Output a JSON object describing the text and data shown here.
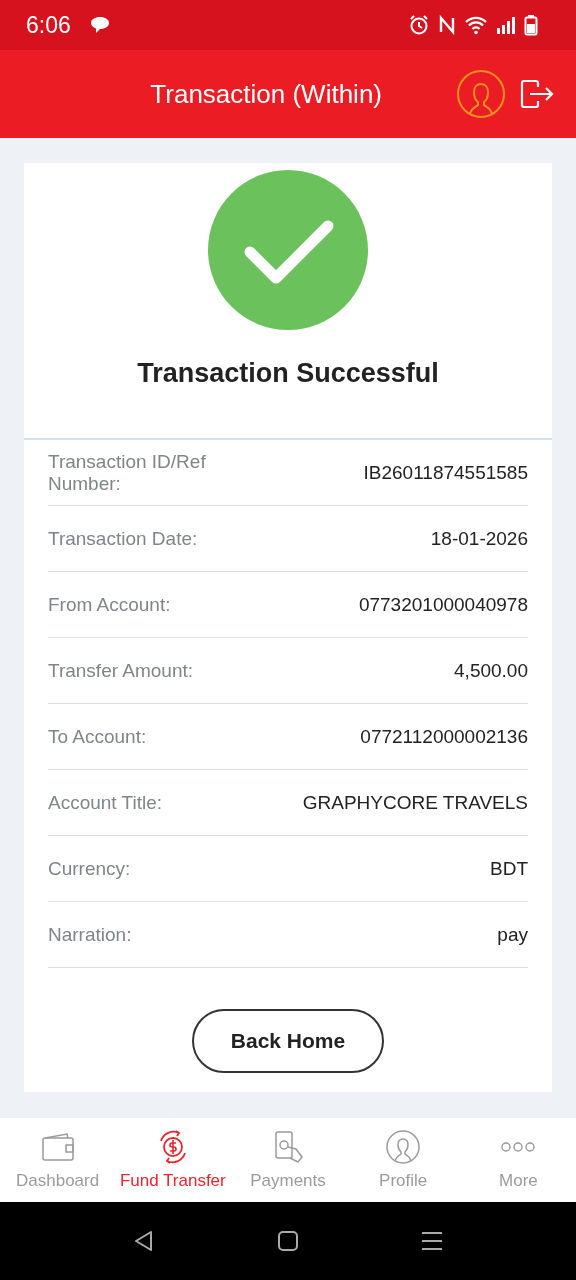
{
  "status_bar": {
    "time": "6:06"
  },
  "header": {
    "title": "Transaction (Within)"
  },
  "result": {
    "title": "Transaction Successful"
  },
  "details": [
    {
      "label": "Transaction ID/Ref Number:",
      "value": "IB26011874551585"
    },
    {
      "label": "Transaction Date:",
      "value": "18-01-2026"
    },
    {
      "label": "From Account:",
      "value": "0773201000040978"
    },
    {
      "label": "Transfer Amount:",
      "value": "4,500.00"
    },
    {
      "label": "To Account:",
      "value": "0772112000002136"
    },
    {
      "label": "Account Title:",
      "value": "GRAPHYCORE TRAVELS"
    },
    {
      "label": "Currency:",
      "value": "BDT"
    },
    {
      "label": "Narration:",
      "value": "pay"
    }
  ],
  "back_button": "Back Home",
  "bottom_nav": [
    {
      "kind": "wallet",
      "label": "Dashboard",
      "selected": false
    },
    {
      "kind": "transfer",
      "label": "Fund Transfer",
      "selected": true
    },
    {
      "kind": "payments",
      "label": "Payments",
      "selected": false
    },
    {
      "kind": "profile",
      "label": "Profile",
      "selected": false
    },
    {
      "kind": "more",
      "label": "More",
      "selected": false
    }
  ]
}
